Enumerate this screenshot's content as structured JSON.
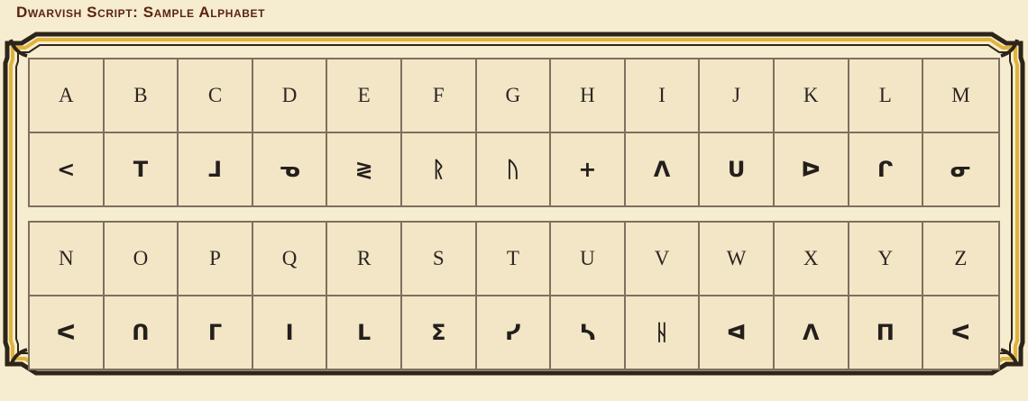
{
  "title": "Dwarvish Script: Sample Alphabet",
  "colors": {
    "background": "#f6ecd0",
    "title": "#5a2410",
    "frame_gold": "#e0b43a",
    "frame_dark": "#2e2418",
    "grid_lines": "#7e6f5e"
  },
  "table1": {
    "letters": [
      "A",
      "B",
      "C",
      "D",
      "E",
      "F",
      "G",
      "H",
      "I",
      "J",
      "K",
      "L",
      "M"
    ],
    "runes": [
      "<",
      "T",
      "ᒧ",
      "ᓀ",
      "≷",
      "ᚱ",
      "ᚢ",
      "+",
      "ᐱ",
      "ᑌ",
      "ᐅ",
      "ᒋ",
      "ᓂ"
    ]
  },
  "table2": {
    "letters": [
      "N",
      "O",
      "P",
      "Q",
      "R",
      "S",
      "T",
      "U",
      "V",
      "W",
      "X",
      "Y",
      "Z"
    ],
    "runes": [
      "ᐸ",
      "ᑎ",
      "Γ",
      "I",
      "ᒪ",
      "Σ",
      "ᓯ",
      "ᓴ",
      "ᚺ",
      "ᐊ",
      "ᐱ",
      "Π",
      "ᐸ"
    ]
  }
}
